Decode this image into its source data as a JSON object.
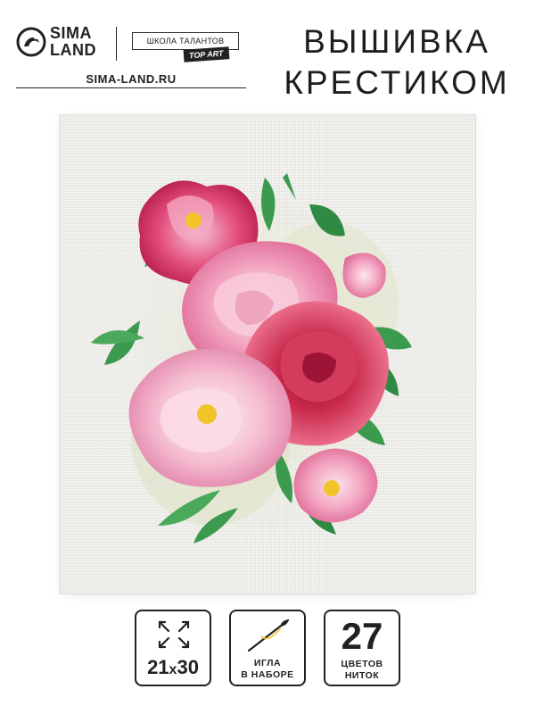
{
  "brand": {
    "logo_text_line1": "SIMA",
    "logo_text_line2": "LAND",
    "school_label": "ШКОЛА ТАЛАНТОВ",
    "top_art_label": "TOP ART",
    "website": "SIMA-LAND.RU"
  },
  "title": {
    "line1": "ВЫШИВКА",
    "line2": "КРЕСТИКОМ"
  },
  "badges": {
    "size": {
      "width": "21",
      "separator": "x",
      "height": "30",
      "icon": "expand-arrows-icon"
    },
    "needle": {
      "line1": "ИГЛА",
      "line2": "В НАБОРЕ",
      "icon": "needle-icon"
    },
    "colors": {
      "count": "27",
      "line1": "ЦВЕТОВ",
      "line2": "НИТОК"
    }
  },
  "colors": {
    "ink": "#222222",
    "rose_deep": "#c8284a",
    "rose_pink": "#ef8fb2",
    "leaf_green": "#3c9a4e",
    "center_yellow": "#f2c42a"
  }
}
